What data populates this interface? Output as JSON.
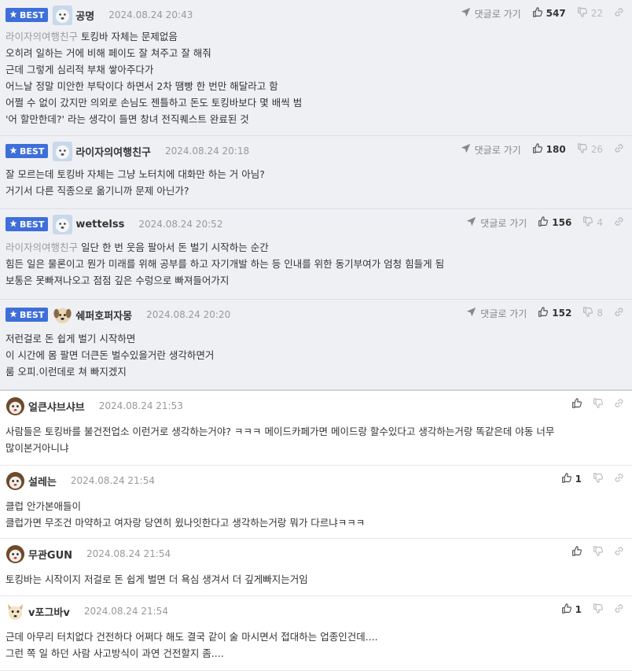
{
  "labels": {
    "best": "BEST",
    "reply": "댓글로 가기"
  },
  "colors": {
    "best_badge": "#3e6fd9",
    "best_bg": "#eef0f4",
    "mention": "#9a9a9a"
  },
  "comments": [
    {
      "best": true,
      "avatar": "white-dog-avatar",
      "nick": "공명",
      "date": "2024.08.24 20:43",
      "likes": "547",
      "dislikes": "22",
      "lines": [
        {
          "mention": "라이자의여행친구",
          "text": " 토킹바 자체는 문제없음"
        },
        {
          "mention": "",
          "text": "오히려 일하는 거에 비해 페이도 잘 쳐주고 잘 해줘"
        },
        {
          "mention": "",
          "text": "근데 그렇게 심리적 부채 쌓아주다가"
        },
        {
          "mention": "",
          "text": "어느날 정말 미안한 부탁이다 하면서 2차 땜빵 한 번만 해달라고 함"
        },
        {
          "mention": "",
          "text": "어쩔 수 없이 갔지만 의외로 손님도 젠틀하고 돈도 토킹바보다 몇 배씩 범"
        },
        {
          "mention": "",
          "text": "'어 할만한데?' 라는 생각이 들면 창녀 전직퀘스트 완료된 것"
        }
      ]
    },
    {
      "best": true,
      "avatar": "white-dog-avatar",
      "nick": "라이자의여행친구",
      "date": "2024.08.24 20:18",
      "likes": "180",
      "dislikes": "26",
      "lines": [
        {
          "mention": "",
          "text": "잘 모르는데 토킹바 자체는 그냥 노터치에 대화만 하는 거 아님?"
        },
        {
          "mention": "",
          "text": "거기서 다른 직종으로 옮기니까 문제 아닌가?"
        }
      ]
    },
    {
      "best": true,
      "avatar": "white-dog-avatar",
      "nick": "wettelss",
      "date": "2024.08.24 20:52",
      "likes": "156",
      "dislikes": "4",
      "lines": [
        {
          "mention": "라이자의여행친구",
          "text": " 일단 한 번 웃음 팔아서 돈 벌기 시작하는 순간"
        },
        {
          "mention": "",
          "text": "힘든 일은 물론이고 뭔가 미래를 위해 공부를 하고 자기개발 하는 등 인내를 위한 동기부여가 엄청 힘들게 됨"
        },
        {
          "mention": "",
          "text": "보통은 못빠져나오고 점점 깊은 수렁으로 빠져들어가지"
        }
      ]
    },
    {
      "best": true,
      "avatar": "puppy-avatar",
      "nick": "쉐퍼호퍼자몽",
      "date": "2024.08.24 20:20",
      "likes": "152",
      "dislikes": "8",
      "lines": [
        {
          "mention": "",
          "text": "저런걸로 돈 쉽게 벌기 시작하면"
        },
        {
          "mention": "",
          "text": "이 시간에 몸 팔면 더큰돈 벌수있을거란 생각하면거"
        },
        {
          "mention": "",
          "text": "룸 오피.이런데로 쳐 빠지겠지"
        }
      ]
    },
    {
      "best": false,
      "avatar": "brown-dog-avatar",
      "nick": "얼큰샤브샤브",
      "date": "2024.08.24 21:53",
      "likes": "",
      "dislikes": "",
      "lines": [
        {
          "mention": "",
          "text": "사람들은 토킹바를 불건전업소 이런거로 생각하는거야? ㅋㅋㅋ 메이드카페가면 메이드랑 할수있다고 생각하는거랑 똑같은데 야동 너무"
        },
        {
          "mention": "",
          "text": "많이본거아니냐"
        }
      ]
    },
    {
      "best": false,
      "avatar": "brown-dog-avatar",
      "nick": "설레는",
      "date": "2024.08.24 21:54",
      "likes": "1",
      "dislikes": "",
      "lines": [
        {
          "mention": "",
          "text": "클럽 안가본애들이"
        },
        {
          "mention": "",
          "text": "클럽가면 무조건 마약하고 여자랑 당연히 윘나잇한다고 생각하는거랑 뭐가 다르냐ㅋㅋㅋ"
        }
      ]
    },
    {
      "best": false,
      "avatar": "brown-dog-avatar",
      "nick": "무관GUN",
      "date": "2024.08.24 21:54",
      "likes": "",
      "dislikes": "",
      "lines": [
        {
          "mention": "",
          "text": "토킹바는 시작이지 저걸로 돈 쉽게 벌면 더 욕심 생겨서 더 깊게빠지는거임"
        }
      ]
    },
    {
      "best": false,
      "avatar": "fox-avatar",
      "nick": "v포그바v",
      "date": "2024.08.24 21:54",
      "likes": "1",
      "dislikes": "",
      "lines": [
        {
          "mention": "",
          "text": "근데 아무리 터치없다 건전하다 어쩌다 해도 결국 같이 술 마시면서 접대하는 업종인건데...."
        },
        {
          "mention": "",
          "text": "그런 쪽 일 하던 사람 사고방식이 과연 건전할지 좀...."
        }
      ]
    }
  ]
}
